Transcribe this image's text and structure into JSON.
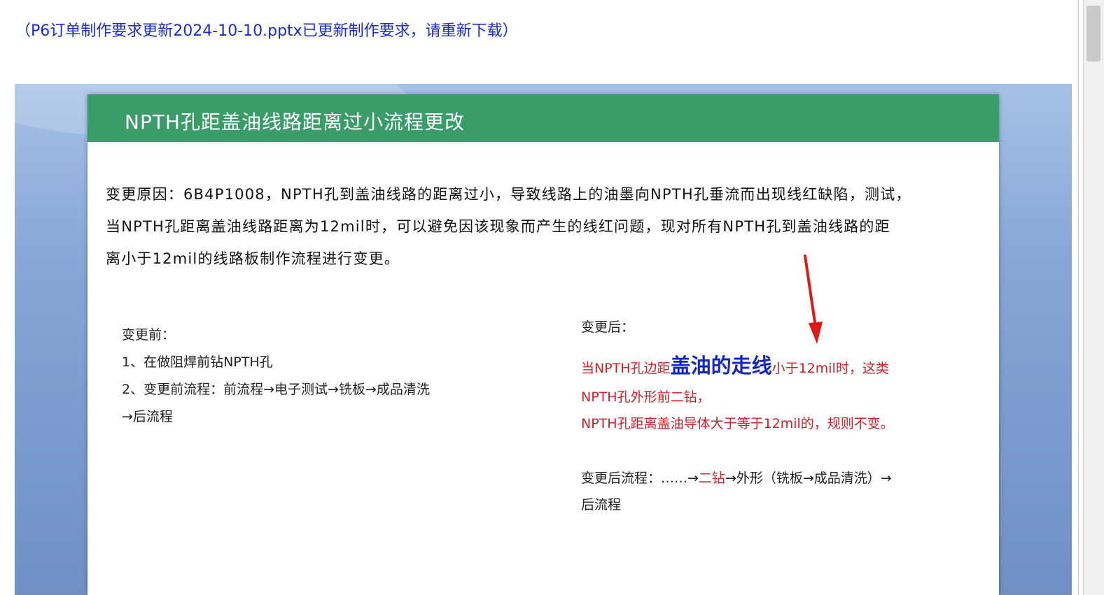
{
  "notice": "（P6订单制作要求更新2024-10-10.pptx已更新制作要求，请重新下载）",
  "slide": {
    "title": "NPTH孔距盖油线路距离过小流程更改",
    "reason_lines": [
      "变更原因：6B4P1008，NPTH孔到盖油线路的距离过小，导致线路上的油墨向NPTH孔垂流而出现线红缺陷，测试，",
      "当NPTH孔距离盖油线路距离为12mil时，可以避免因该现象而产生的线红问题，现对所有NPTH孔到盖油线路的距",
      "离小于12mil的线路板制作流程进行变更。"
    ],
    "before": {
      "heading": "变更前：",
      "item1": "1、在做阻焊前钻NPTH孔",
      "item2": "2、变更前流程：前流程→电子测试→铣板→成品清洗",
      "item2_cont": "→后流程"
    },
    "after": {
      "heading": "变更后：",
      "rule_prefix": "当NPTH孔边距",
      "rule_emphasis": "盖油的走线",
      "rule_suffix": "小于12mil时，这类",
      "rule_line2": "NPTH孔外形前二钻，",
      "rule_line3": "NPTH孔距离盖油导体大于等于12mil的，规则不变。",
      "flow_prefix": "变更后流程：……→",
      "flow_highlight": "二钻",
      "flow_suffix": "→外形（铣板→成品清洗）→",
      "flow_cont": "后流程"
    }
  },
  "colors": {
    "notice_text": "#1a2bd0",
    "header_green": "#3a9c68",
    "rule_red": "#d0202a",
    "emphasis_blue": "#1526c8",
    "arrow_red": "#e01818"
  }
}
